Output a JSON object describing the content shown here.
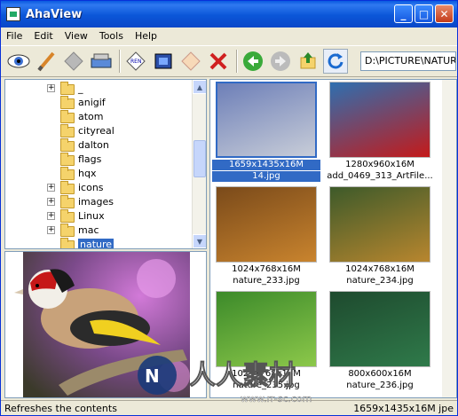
{
  "window": {
    "title": "AhaView"
  },
  "menu": [
    "File",
    "Edit",
    "View",
    "Tools",
    "Help"
  ],
  "toolbar": {
    "address": "D:\\PICTURE\\NATURE",
    "tools": [
      "view-eye-icon",
      "brush-icon",
      "eraser-icon",
      "scanner-icon",
      "rename-icon",
      "film-icon",
      "folder-move-icon",
      "delete-icon",
      "back-icon",
      "forward-icon",
      "up-folder-icon",
      "refresh-icon"
    ]
  },
  "tree": {
    "items": [
      {
        "label": "_",
        "expander": "+"
      },
      {
        "label": "anigif",
        "expander": ""
      },
      {
        "label": "atom",
        "expander": ""
      },
      {
        "label": "cityreal",
        "expander": ""
      },
      {
        "label": "dalton",
        "expander": ""
      },
      {
        "label": "flags",
        "expander": ""
      },
      {
        "label": "hqx",
        "expander": ""
      },
      {
        "label": "icons",
        "expander": "+"
      },
      {
        "label": "images",
        "expander": "+"
      },
      {
        "label": "Linux",
        "expander": "+"
      },
      {
        "label": "mac",
        "expander": "+"
      },
      {
        "label": "nature",
        "expander": "",
        "selected": true
      }
    ]
  },
  "thumbnails": [
    {
      "dims": "1659x1435x16M",
      "name": "14.jpg",
      "selected": true,
      "colors": [
        "#6d7fb8",
        "#c8cdd8"
      ]
    },
    {
      "dims": "1280x960x16M",
      "name": "add_0469_313_ArtFile...",
      "colors": [
        "#2e6fb0",
        "#c41a1a"
      ]
    },
    {
      "dims": "1024x768x16M",
      "name": "nature_233.jpg",
      "colors": [
        "#7a4a1a",
        "#c9842e"
      ]
    },
    {
      "dims": "1024x768x16M",
      "name": "nature_234.jpg",
      "colors": [
        "#3d5a2a",
        "#b8862e"
      ]
    },
    {
      "dims": "1024x768x16M",
      "name": "nature_235.jpg",
      "colors": [
        "#3c8a2a",
        "#8cc84a"
      ]
    },
    {
      "dims": "800x600x16M",
      "name": "nature_236.jpg",
      "colors": [
        "#1e4a2e",
        "#2f7a4a"
      ]
    }
  ],
  "status": {
    "left": "Refreshes the contents",
    "right": "1659x1435x16M jpe"
  },
  "watermark": {
    "text": "人人素材",
    "url": "www.rr-sc.com"
  }
}
